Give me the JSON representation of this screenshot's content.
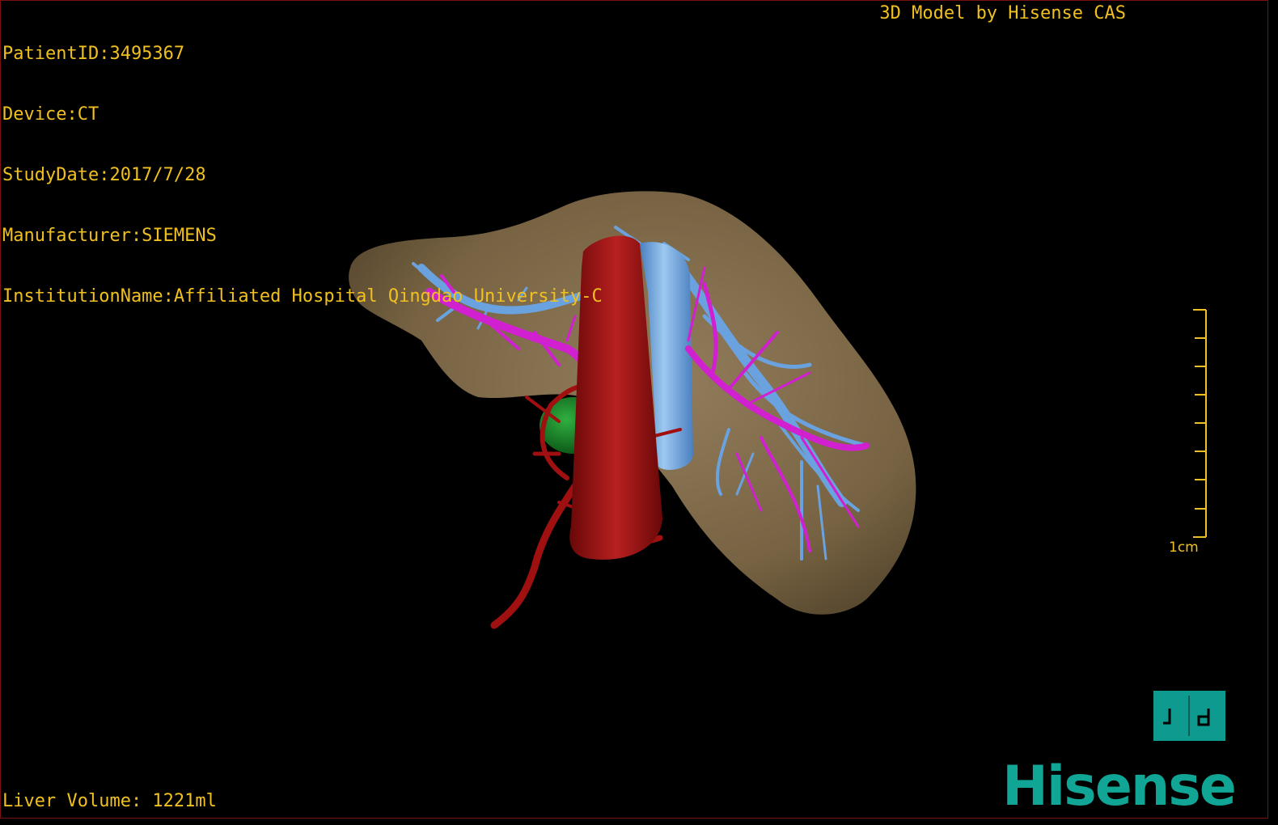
{
  "dicom_info": {
    "patient_id": "PatientID:3495367",
    "device": "Device:CT",
    "study_date": "StudyDate:2017/7/28",
    "manufacturer": "Manufacturer:SIEMENS",
    "institution": "InstitutionName:Affiliated Hospital Qingdao University-C"
  },
  "model_credit": "3D Model by Hisense CAS",
  "liver_volume": "Liver Volume: 1221ml",
  "scale_bar": {
    "label": "1cm",
    "tick_count": 9
  },
  "brand": {
    "logo_text": "Hisense",
    "icon": "hisense-cas-logo-icon"
  },
  "colors": {
    "overlay_text": "#f0c020",
    "liver": "#8a7350",
    "hepatic_vein": "#6aa2e0",
    "portal_vein": "#d020d0",
    "artery": "#a01010",
    "tumor": "#1a8a2a",
    "brand": "#10a595",
    "border": "#7a1010"
  }
}
